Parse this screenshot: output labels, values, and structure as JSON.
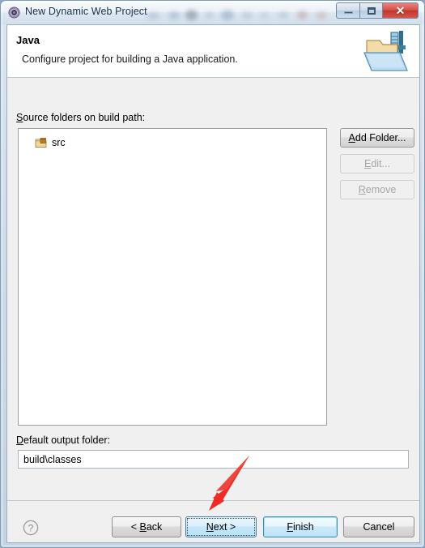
{
  "window": {
    "title": "New Dynamic Web Project",
    "title_icon": "eclipse-wizard-icon",
    "controls": {
      "minimize": {
        "label": "–",
        "name": "minimize-icon"
      },
      "maximize": {
        "label": "□",
        "name": "restore-icon"
      },
      "close": {
        "label": "✕",
        "name": "close-icon"
      }
    },
    "frame_color": "#7d9cbb",
    "titlebar_text_color": "#16324f",
    "close_button_color": "#c0352c"
  },
  "header": {
    "title": "Java",
    "description": "Configure project for building a Java application.",
    "icon": "open-folder-wizard-icon",
    "background": "#ffffff"
  },
  "body": {
    "background": "#f0f0f0",
    "source_folders": {
      "label_prefix": "",
      "label_mnemonic": "S",
      "label_suffix": "ource folders on build path:",
      "label_full": "Source folders on build path:",
      "items": [
        {
          "name": "src",
          "icon": "source-folder-icon"
        }
      ]
    },
    "side_buttons": [
      {
        "label_mnemonic": "A",
        "label_suffix": "dd Folder...",
        "label_full": "Add Folder...",
        "enabled": true,
        "name": "add-folder-button"
      },
      {
        "label_mnemonic": "E",
        "label_suffix": "dit...",
        "label_full": "Edit...",
        "enabled": false,
        "name": "edit-button"
      },
      {
        "label_mnemonic": "R",
        "label_suffix": "emove",
        "label_full": "Remove",
        "enabled": false,
        "name": "remove-button"
      }
    ],
    "output_folder": {
      "label_mnemonic": "D",
      "label_suffix": "efault output folder:",
      "label_full": "Default output folder:",
      "value": "build\\classes",
      "placeholder": ""
    }
  },
  "footer": {
    "help_icon": "help-question-icon",
    "buttons": [
      {
        "label_full": "< Back",
        "label_pre": "< ",
        "label_mnemonic": "B",
        "label_suffix": "ack",
        "state": "normal",
        "name": "back-button"
      },
      {
        "label_full": "Next >",
        "label_pre": "",
        "label_mnemonic": "N",
        "label_suffix": "ext >",
        "state": "hover",
        "name": "next-button"
      },
      {
        "label_full": "Finish",
        "label_pre": "",
        "label_mnemonic": "F",
        "label_suffix": "inish",
        "state": "default",
        "name": "finish-button"
      },
      {
        "label_full": "Cancel",
        "label_pre": "",
        "label_mnemonic": "",
        "label_suffix": "Cancel",
        "state": "normal",
        "name": "cancel-button"
      }
    ]
  },
  "annotation": {
    "type": "arrow",
    "color": "#ee2b24",
    "points_at": "next-button",
    "direction": "down-left"
  }
}
